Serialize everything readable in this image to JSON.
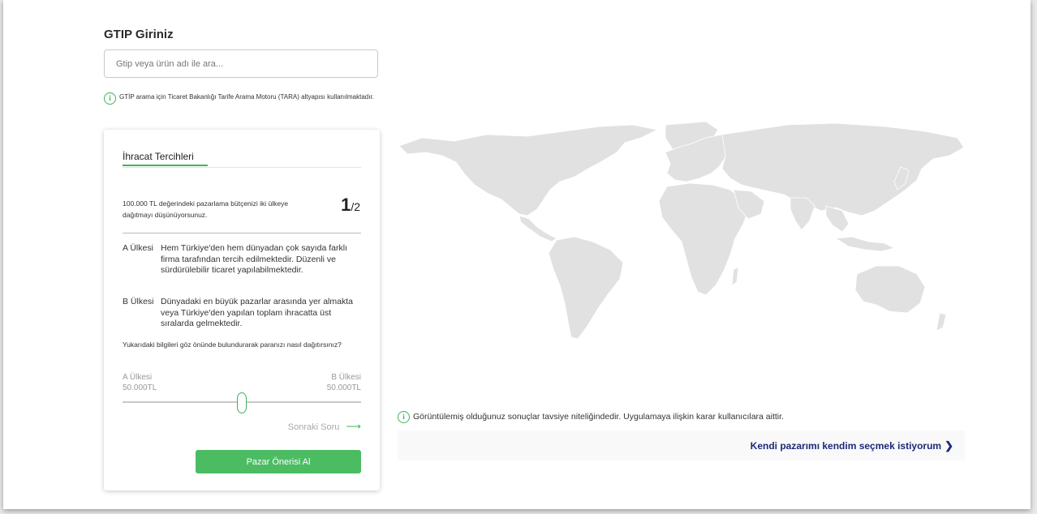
{
  "search": {
    "title": "GTIP Giriniz",
    "placeholder": "Gtip veya ürün adı ile ara...",
    "note": "GTİP arama için Ticaret Bakanlığı Tarife Arama Motoru (TARA) altyapısı kullanılmaktadır."
  },
  "card": {
    "tab_title": "İhracat Tercihleri",
    "question": "100.000 TL değerindeki pazarlama bütçenizi iki ülkeye dağıtmayı düşünüyorsunuz.",
    "step_current": "1",
    "step_total": "/2",
    "options": [
      {
        "label": "A Ülkesi",
        "description": "Hem Türkiye'den hem dünyadan çok sayıda farklı firma tarafından tercih edilmektedir. Düzenli ve sürdürülebilir ticaret yapılabilmektedir."
      },
      {
        "label": "B Ülkesi",
        "description": "Dünyadaki en büyük pazarlar arasında yer almakta veya Türkiye'den yapılan toplam ihracatta üst sıralarda gelmektedir."
      }
    ],
    "prompt": "Yukarıdaki bilgileri göz önünde bulundurarak paranızı nasıl dağıtırsınız?",
    "slider": {
      "left_label": "A Ülkesi",
      "left_value": "50.000TL",
      "right_label": "B Ülkesi",
      "right_value": "50.000TL",
      "position": 0.5
    },
    "next_label": "Sonraki Soru",
    "cta_label": "Pazar Önerisi Al"
  },
  "disclaimer": "Görüntülemiş olduğunuz sonuçlar tavsiye niteliğindedir. Uygulamaya ilişkin karar kullanıcılara aittir.",
  "own_market_link": "Kendi pazarımı kendim seçmek istiyorum",
  "colors": {
    "accent": "#4cbc63",
    "link": "#1b2a7a",
    "map": "#e1e1e1"
  }
}
